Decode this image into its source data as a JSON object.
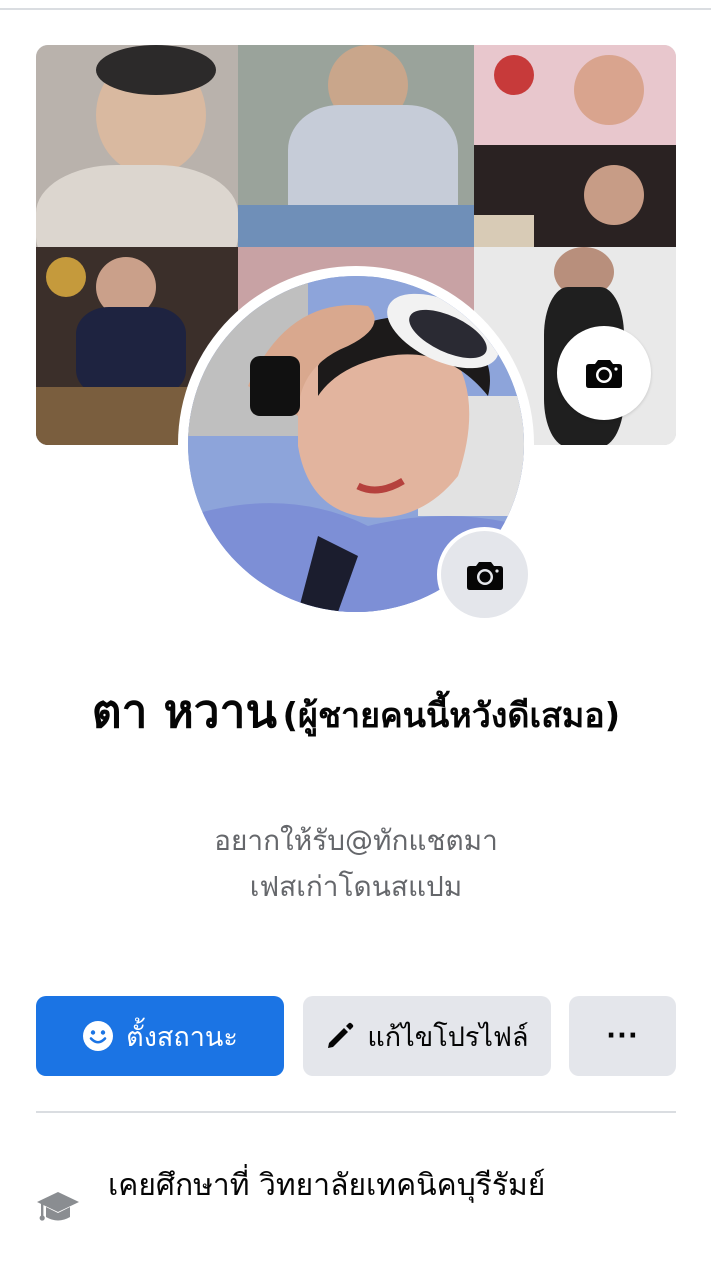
{
  "profile": {
    "name": "ตา หวาน",
    "nickname": "(ผู้ชายคนนี้หวังดีเสมอ)",
    "bio_line1": "อยากให้รับ@ทักแชตมา",
    "bio_line2": "เฟสเก่าโดนสแปม"
  },
  "actions": {
    "status_label": "ตั้งสถานะ",
    "edit_label": "แก้ไขโปรไฟล์",
    "more_label": "···"
  },
  "details": {
    "education": "เคยศึกษาที่ วิทยาลัยเทคนิคบุรีรัมย์"
  },
  "icons": {
    "cover_camera": "camera-icon",
    "avatar_camera": "camera-icon",
    "status": "smiley-icon",
    "edit": "pencil-icon",
    "more": "more-dots-icon",
    "education": "graduation-cap-icon"
  },
  "colors": {
    "primary": "#1b74e4",
    "secondary_bg": "#e4e6eb",
    "muted_text": "#65676b"
  }
}
